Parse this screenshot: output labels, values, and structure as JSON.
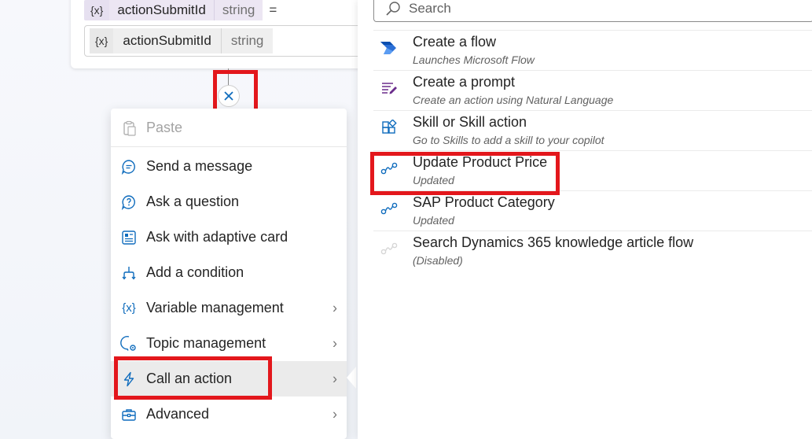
{
  "node": {
    "variable_icon": "{x}",
    "variable_name": "actionSubmitId",
    "variable_type": "string",
    "operator": "=",
    "value_icon": "{x}",
    "value_name": "actionSubmitId",
    "value_type": "string"
  },
  "add_node": {
    "close_glyph": "×",
    "icon": "close-icon"
  },
  "menu": {
    "items": [
      {
        "label": "Paste",
        "icon": "paste-icon",
        "disabled": true
      },
      {
        "label": "Send a message",
        "icon": "message-icon"
      },
      {
        "label": "Ask a question",
        "icon": "question-icon"
      },
      {
        "label": "Ask with adaptive card",
        "icon": "adaptive-card-icon"
      },
      {
        "label": "Add a condition",
        "icon": "condition-icon"
      },
      {
        "label": "Variable management",
        "icon": "variable-icon",
        "submenu": true
      },
      {
        "label": "Topic management",
        "icon": "topic-icon",
        "submenu": true
      },
      {
        "label": "Call an action",
        "icon": "lightning-icon",
        "submenu": true,
        "active": true
      },
      {
        "label": "Advanced",
        "icon": "toolbox-icon",
        "submenu": true
      }
    ],
    "variable_glyph": "{x}",
    "chevron": "›"
  },
  "flyout": {
    "search_placeholder": "Search",
    "items": [
      {
        "title": "Create a flow",
        "subtitle": "Launches Microsoft Flow",
        "icon": "power-automate-icon"
      },
      {
        "title": "Create a prompt",
        "subtitle": "Create an action using Natural Language",
        "icon": "prompt-icon"
      },
      {
        "title": "Skill or Skill action",
        "subtitle": "Go to Skills to add a skill to your copilot",
        "icon": "skill-icon"
      },
      {
        "title": "Update Product Price",
        "subtitle": "Updated",
        "icon": "flow-icon"
      },
      {
        "title": "SAP Product Category",
        "subtitle": "Updated",
        "icon": "flow-icon"
      },
      {
        "title": "Search Dynamics 365 knowledge article flow",
        "subtitle": "(Disabled)",
        "icon": "flow-disabled-icon"
      }
    ]
  },
  "colors": {
    "accent": "#0f6cbd",
    "highlight": "#e3171c",
    "prompt_purple": "#6b2d8c"
  }
}
